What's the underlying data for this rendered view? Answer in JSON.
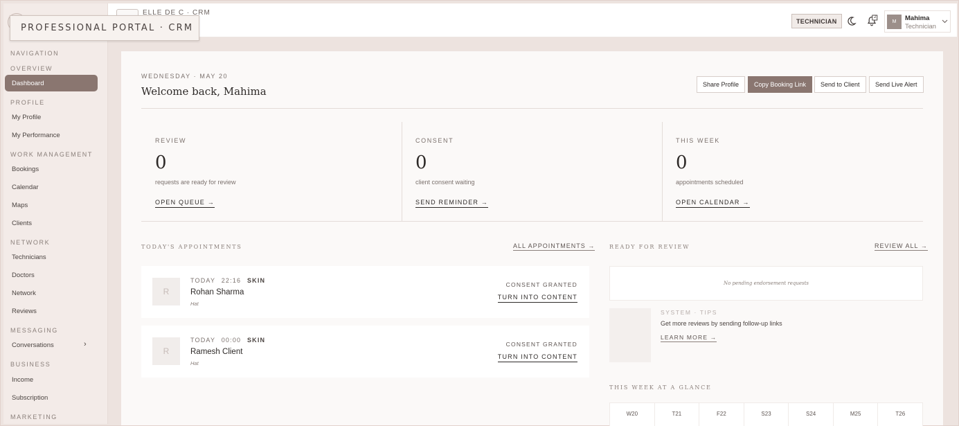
{
  "brand": {
    "tooltip": "PROFESSIONAL PORTAL · CRM",
    "top_text": "ELLE DE C · CRM"
  },
  "sidebar": {
    "groups": [
      {
        "label": "NAVIGATION",
        "items": []
      },
      {
        "label": "OVERVIEW",
        "items": [
          {
            "label": "Dashboard",
            "active": true
          }
        ]
      },
      {
        "label": "PROFILE",
        "items": [
          {
            "label": "My Profile"
          },
          {
            "label": "My Performance"
          }
        ]
      },
      {
        "label": "WORK MANAGEMENT",
        "items": [
          {
            "label": "Bookings"
          },
          {
            "label": "Calendar"
          },
          {
            "label": "Maps"
          },
          {
            "label": "Clients"
          }
        ]
      },
      {
        "label": "NETWORK",
        "items": [
          {
            "label": "Technicians"
          },
          {
            "label": "Doctors"
          },
          {
            "label": "Network"
          },
          {
            "label": "Reviews"
          }
        ]
      },
      {
        "label": "MESSAGING",
        "items": [
          {
            "label": "Conversations",
            "has_submenu": true
          }
        ]
      },
      {
        "label": "BUSINESS",
        "items": [
          {
            "label": "Income"
          },
          {
            "label": "Subscription"
          }
        ]
      },
      {
        "label": "MARKETING",
        "items": []
      }
    ]
  },
  "topbar": {
    "role_badge": "TECHNICIAN",
    "notification_count": "2",
    "user": {
      "initial": "M",
      "name": "Mahima",
      "role": "Technician"
    },
    "icons": {
      "theme": "moon-icon",
      "notifications": "bell-icon",
      "menu": "chevron-down-icon"
    }
  },
  "header": {
    "date": "WEDNESDAY · MAY 20",
    "welcome": "Welcome back, Mahima",
    "buttons": {
      "share_profile": "Share Profile",
      "copy_booking_link": "Copy Booking Link",
      "send_to_client": "Send to Client",
      "send_live_alert": "Send Live Alert"
    }
  },
  "stats": [
    {
      "label": "REVIEW",
      "value": "0",
      "desc": "requests are ready for review",
      "link": "OPEN QUEUE →"
    },
    {
      "label": "CONSENT",
      "value": "0",
      "desc": "client consent waiting",
      "link": "SEND REMINDER →"
    },
    {
      "label": "THIS WEEK",
      "value": "0",
      "desc": "appointments scheduled",
      "link": "OPEN CALENDAR →"
    }
  ],
  "appointments": {
    "title": "TODAY'S APPOINTMENTS",
    "all_link": "ALL APPOINTMENTS →",
    "items": [
      {
        "initial": "R",
        "day": "TODAY",
        "time": "22:16",
        "type": "SKIN",
        "name": "Rohan Sharma",
        "sub": "Hat",
        "status": "CONSENT GRANTED",
        "action": "TURN INTO CONTENT"
      },
      {
        "initial": "R",
        "day": "TODAY",
        "time": "00:00",
        "type": "SKIN",
        "name": "Ramesh Client",
        "sub": "Hat",
        "status": "CONSENT GRANTED",
        "action": "TURN INTO CONTENT"
      }
    ]
  },
  "review": {
    "title": "READY FOR REVIEW",
    "all_link": "REVIEW ALL →",
    "empty": "No pending endorsement requests"
  },
  "tips": {
    "label": "SYSTEM · TIPS",
    "text": "Get more reviews by sending follow-up links",
    "link": "LEARN MORE →"
  },
  "week": {
    "title": "THIS WEEK AT A GLANCE",
    "days": [
      "W20",
      "T21",
      "F22",
      "S23",
      "S24",
      "M25",
      "T26"
    ]
  }
}
